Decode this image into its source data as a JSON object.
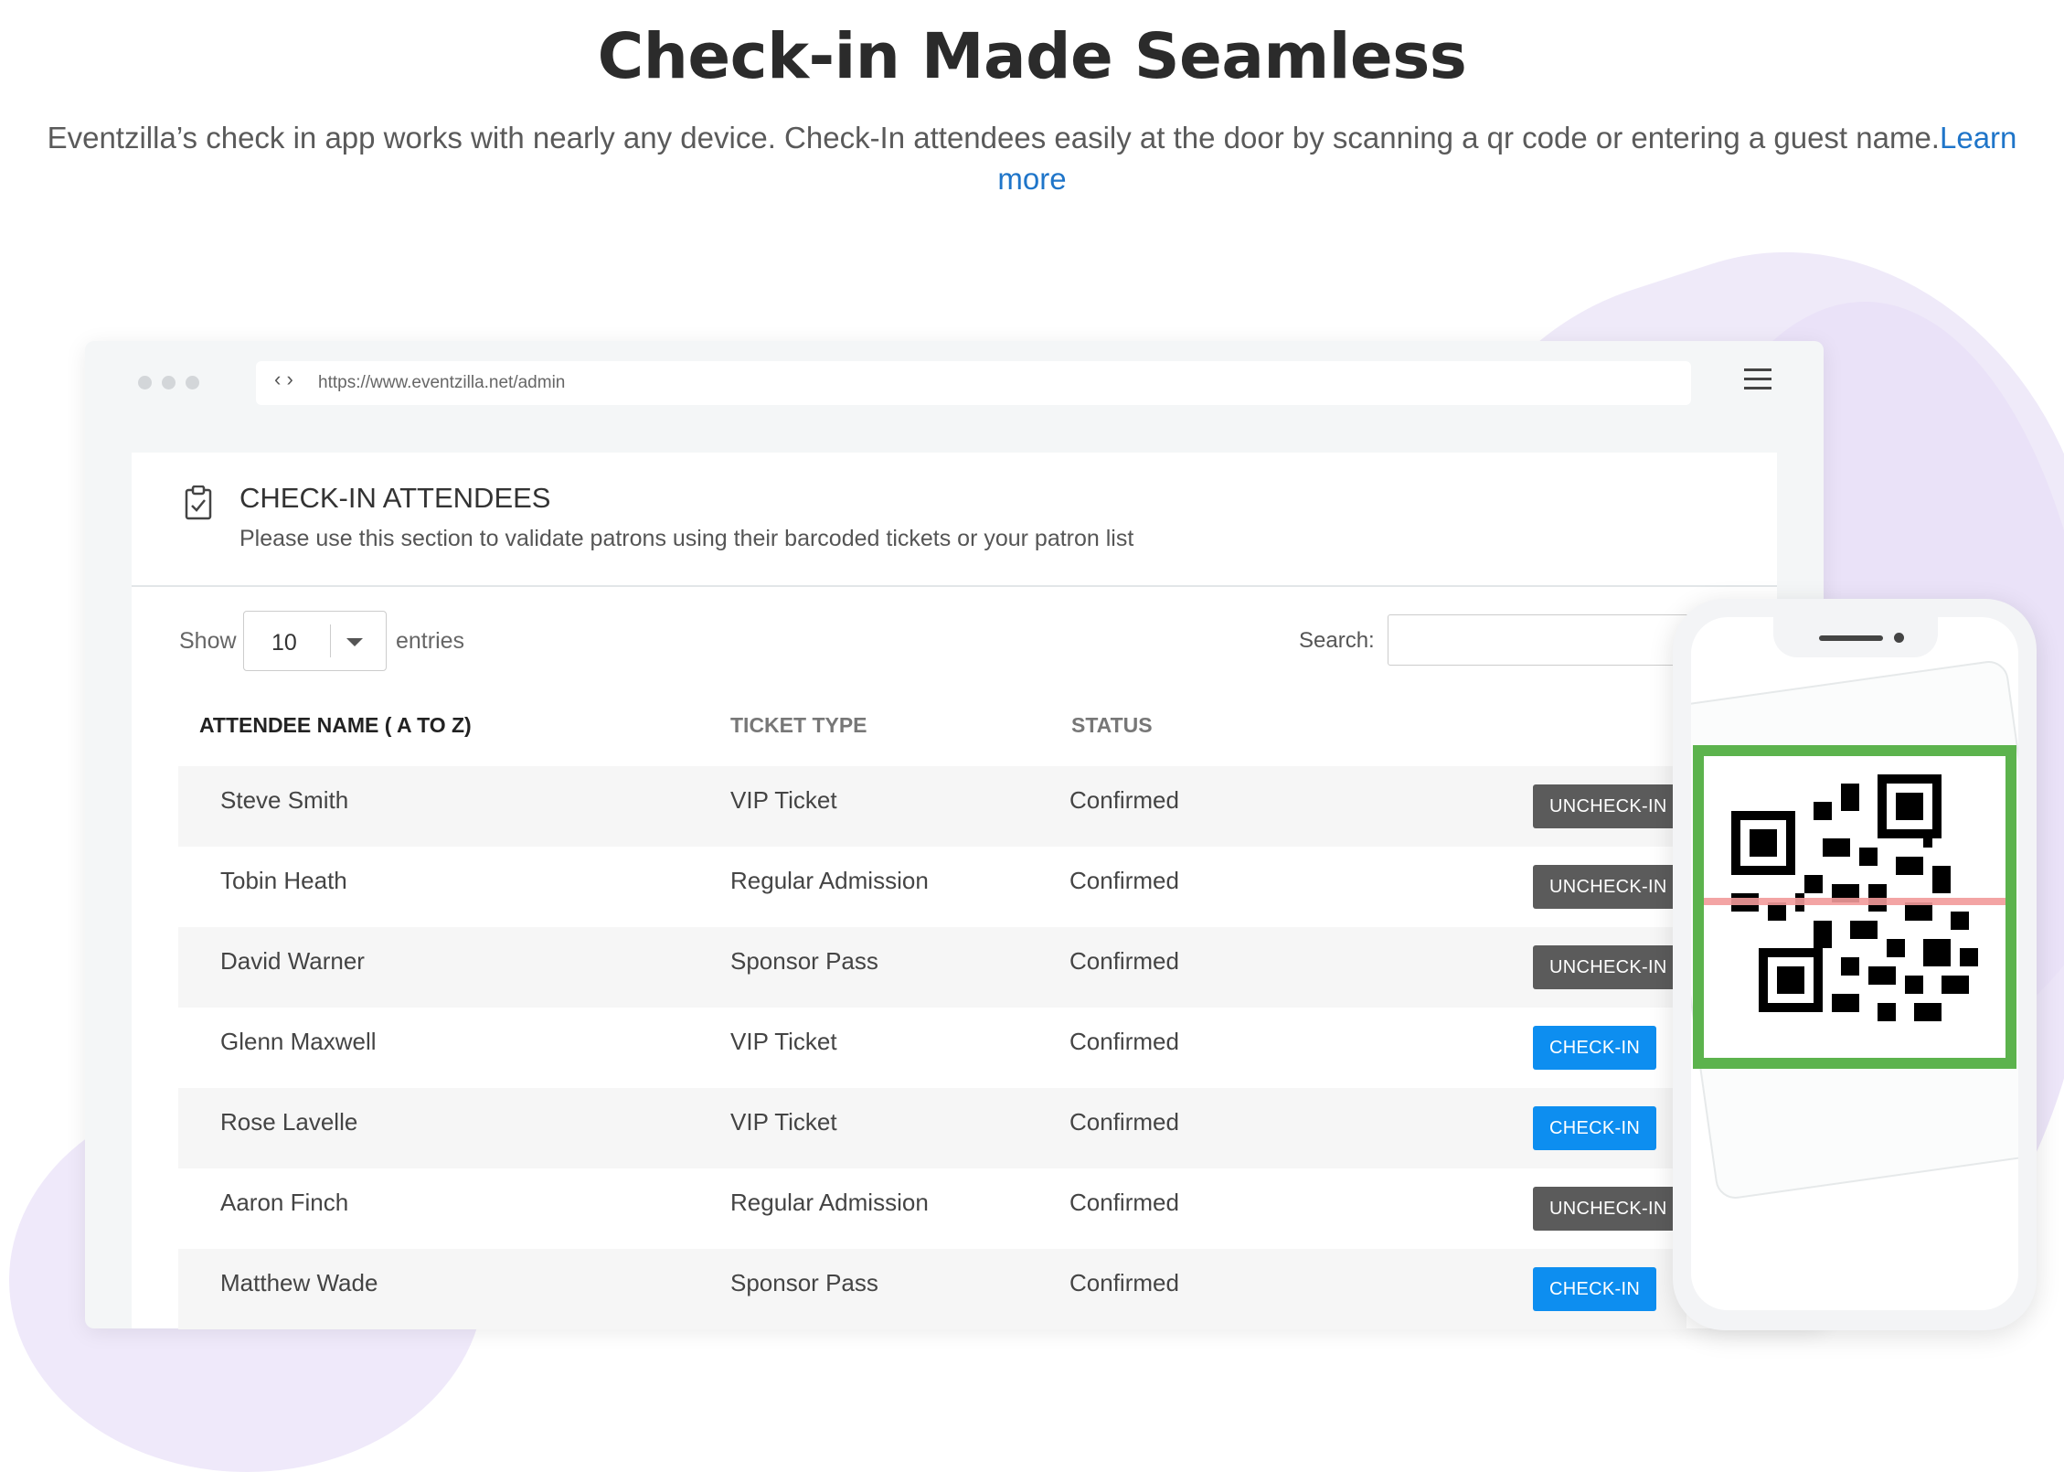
{
  "hero": {
    "title": "Check-in Made Seamless",
    "subtitle": "Eventzilla’s check in app works with nearly any device. Check-In attendees easily at the door by scanning a qr code or entering a guest name.",
    "learn_more_1": "Learn",
    "learn_more_2": "more"
  },
  "browser": {
    "nav_arrows": "‹ ›",
    "url": "https://www.eventzilla.net/admin",
    "menu_icon": "hamburger-icon"
  },
  "panel": {
    "icon": "clipboard-check-icon",
    "title": "CHECK-IN ATTENDEES",
    "description": "Please use this section to validate patrons using their barcoded tickets or your patron list"
  },
  "controls": {
    "show_label": "Show",
    "entries_value": "10",
    "entries_label": "entries",
    "search_label": "Search:",
    "search_value": ""
  },
  "table": {
    "headers": [
      "ATTENDEE NAME ( A TO Z)",
      "TICKET TYPE",
      "STATUS"
    ],
    "rows": [
      {
        "name": "Steve Smith",
        "type": "VIP Ticket",
        "status": "Confirmed",
        "action": "UNCHECK-IN"
      },
      {
        "name": "Tobin Heath",
        "type": "Regular Admission",
        "status": "Confirmed",
        "action": "UNCHECK-IN"
      },
      {
        "name": "David Warner",
        "type": "Sponsor Pass",
        "status": "Confirmed",
        "action": "UNCHECK-IN"
      },
      {
        "name": "Glenn Maxwell",
        "type": "VIP Ticket",
        "status": "Confirmed",
        "action": "CHECK-IN"
      },
      {
        "name": "Rose Lavelle",
        "type": "VIP Ticket",
        "status": "Confirmed",
        "action": "CHECK-IN"
      },
      {
        "name": "Aaron Finch",
        "type": "Regular Admission",
        "status": "Confirmed",
        "action": "UNCHECK-IN"
      },
      {
        "name": "Matthew Wade",
        "type": "Sponsor Pass",
        "status": "Confirmed",
        "action": "CHECK-IN"
      }
    ]
  },
  "colors": {
    "check_in": "#0d8ef0",
    "uncheck_in": "#5b5b5b",
    "scan_frame": "#5cb34d",
    "link": "#1f75c9"
  },
  "phone": {
    "qr_icon": "qr-code-icon"
  }
}
